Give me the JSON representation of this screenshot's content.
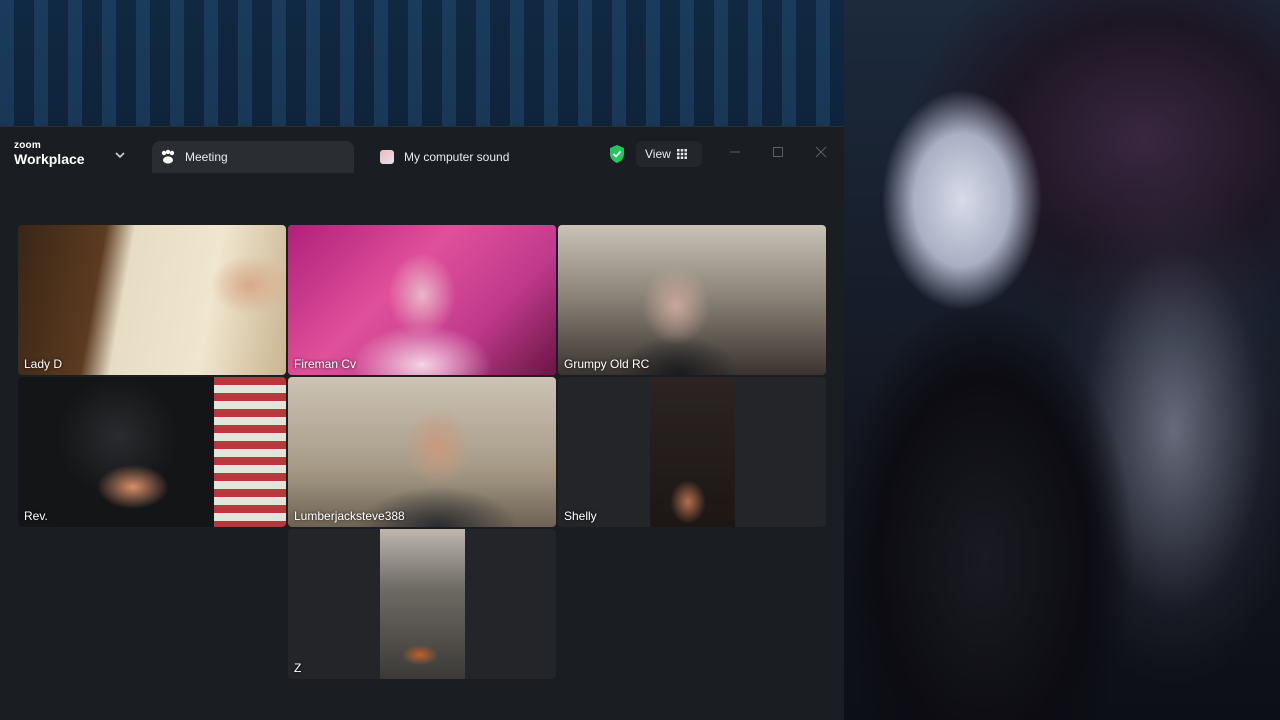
{
  "app": {
    "brand_small": "zoom",
    "brand_big": "Workplace"
  },
  "tabs": [
    {
      "label": "Meeting",
      "icon": "meeting-icon",
      "selected": true
    },
    {
      "label": "My computer sound",
      "icon": "computer-sound-icon",
      "selected": false
    }
  ],
  "toolbar": {
    "view_label": "View",
    "security_icon": "shield-check-icon",
    "security_color": "#22c55e"
  },
  "participants": [
    {
      "name": "Lady D",
      "active_speaker": false
    },
    {
      "name": "Fireman Cv",
      "active_speaker": true
    },
    {
      "name": "Grumpy Old RC",
      "active_speaker": false
    },
    {
      "name": "Rev.",
      "active_speaker": false
    },
    {
      "name": "Lumberjacksteve388",
      "active_speaker": false
    },
    {
      "name": "Shelly",
      "active_speaker": false
    },
    {
      "name": "Z",
      "active_speaker": false
    }
  ],
  "colors": {
    "window_bg": "#1a1d21",
    "active_speaker_border": "#3ddc97"
  }
}
